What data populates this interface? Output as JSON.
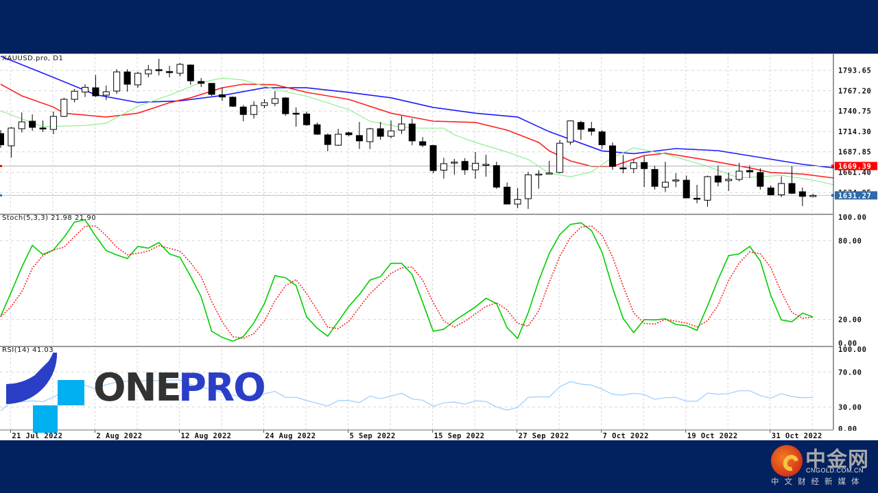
{
  "chart_header": {
    "symbol_timeframe": "XAUUSD.pro, D1"
  },
  "colors": {
    "background_band": "#03215f",
    "bull_candle": "#ffffff",
    "bear_candle": "#000000",
    "ma_blue": "#1a1aff",
    "ma_red": "#ff2020",
    "ma_green": "#90ee90",
    "stoch_main": "#00cc00",
    "stoch_signal": "#ff2020",
    "rsi": "#99ccff",
    "price_line_label": "#ff0000",
    "bid_line_label": "#2e6aa8"
  },
  "chart_data": [
    {
      "type": "candlestick",
      "title": "XAUUSD.pro, D1",
      "ylim": [
        1610,
        1816
      ],
      "grid": true,
      "y_ticks": [
        "1793.65",
        "1767.20",
        "1740.75",
        "1714.30",
        "1687.85",
        "1661.40",
        "1634.95"
      ],
      "x_tick_labels": [
        "21 Jul 2022",
        "2 Aug 2022",
        "12 Aug 2022",
        "24 Aug 2022",
        "5 Sep 2022",
        "15 Sep 2022",
        "27 Sep 2022",
        "7 Oct 2022",
        "19 Oct 2022",
        "31 Oct 2022"
      ],
      "ohlc": [
        [
          1711.5,
          1716,
          1693,
          1697
        ],
        [
          1695.6,
          1720,
          1680.5,
          1718.7
        ],
        [
          1717.8,
          1739,
          1713,
          1726.7
        ],
        [
          1727.6,
          1736.5,
          1715,
          1719.6
        ],
        [
          1718.8,
          1728.5,
          1713.5,
          1717.8
        ],
        [
          1716.9,
          1740,
          1710.7,
          1733.8
        ],
        [
          1733.8,
          1758,
          1733,
          1756
        ],
        [
          1756,
          1769.4,
          1752,
          1766.5
        ],
        [
          1765.5,
          1775.6,
          1759,
          1771.6
        ],
        [
          1771,
          1787.5,
          1759,
          1760.5
        ],
        [
          1761.4,
          1773.8,
          1755,
          1765.8
        ],
        [
          1766.7,
          1795,
          1763,
          1791.6
        ],
        [
          1791.6,
          1795,
          1766,
          1775.6
        ],
        [
          1774.8,
          1791.6,
          1771,
          1789.8
        ],
        [
          1789,
          1800.5,
          1784.5,
          1794.3
        ],
        [
          1794.5,
          1808.5,
          1787,
          1793.8
        ],
        [
          1792,
          1799.6,
          1784.5,
          1791
        ],
        [
          1789.8,
          1803,
          1786,
          1801.4
        ],
        [
          1800.5,
          1801.4,
          1774.8,
          1780
        ],
        [
          1779.2,
          1783.6,
          1772,
          1776.7
        ],
        [
          1776.7,
          1777,
          1760.5,
          1762.4
        ],
        [
          1762,
          1771,
          1754,
          1759
        ],
        [
          1758.8,
          1759.5,
          1746,
          1747
        ],
        [
          1746,
          1748.6,
          1727.6,
          1736.3
        ],
        [
          1736.3,
          1753.6,
          1731,
          1748
        ],
        [
          1748,
          1756,
          1744.5,
          1751.6
        ],
        [
          1750.7,
          1766.7,
          1747,
          1756.9
        ],
        [
          1757.8,
          1758.8,
          1734.5,
          1737.3
        ],
        [
          1738,
          1745.5,
          1720.5,
          1737
        ],
        [
          1737,
          1740,
          1721.6,
          1723
        ],
        [
          1723,
          1725.9,
          1709.8,
          1710.7
        ],
        [
          1709.8,
          1711.6,
          1688.5,
          1697.3
        ],
        [
          1696.4,
          1717.8,
          1695.5,
          1710.7
        ],
        [
          1712.5,
          1714,
          1708,
          1710
        ],
        [
          1709,
          1726.7,
          1691.5,
          1702
        ],
        [
          1701,
          1719,
          1691.5,
          1717.8
        ],
        [
          1717.8,
          1726.7,
          1703.5,
          1708
        ],
        [
          1708,
          1728.5,
          1705.4,
          1715
        ],
        [
          1716,
          1734.5,
          1711,
          1724
        ],
        [
          1724,
          1731,
          1696.4,
          1702
        ],
        [
          1701,
          1707,
          1694,
          1696.4
        ],
        [
          1696,
          1697,
          1660,
          1663.5
        ],
        [
          1664,
          1680,
          1653,
          1672.5
        ],
        [
          1674,
          1678.8,
          1658,
          1674.5
        ],
        [
          1675.4,
          1679.7,
          1658,
          1664.4
        ],
        [
          1664.4,
          1687.6,
          1653,
          1673
        ],
        [
          1671.5,
          1684,
          1655.6,
          1671.6
        ],
        [
          1670,
          1675,
          1639.7,
          1642
        ],
        [
          1642,
          1648,
          1620,
          1620
        ],
        [
          1620,
          1641,
          1614.6,
          1626
        ],
        [
          1627,
          1661.6,
          1613.7,
          1658
        ],
        [
          1658.5,
          1664,
          1640,
          1659
        ],
        [
          1660,
          1676,
          1659,
          1660.3
        ],
        [
          1661,
          1703,
          1660,
          1699
        ],
        [
          1700.5,
          1728.5,
          1697,
          1728
        ],
        [
          1726,
          1728,
          1703.5,
          1717
        ],
        [
          1718,
          1726.7,
          1709,
          1714.5
        ],
        [
          1713.7,
          1716,
          1691.5,
          1697
        ],
        [
          1695.6,
          1700,
          1664.4,
          1668.9
        ],
        [
          1667,
          1684,
          1660,
          1666.5
        ],
        [
          1666,
          1678,
          1660,
          1673.6
        ],
        [
          1674,
          1682,
          1642,
          1666
        ],
        [
          1665,
          1669.6,
          1638.8,
          1643
        ],
        [
          1642,
          1675,
          1636,
          1648.4
        ],
        [
          1651,
          1660,
          1642,
          1651.3
        ],
        [
          1651,
          1657,
          1628,
          1628
        ],
        [
          1627.6,
          1645,
          1621,
          1627
        ],
        [
          1625,
          1657,
          1616.5,
          1655.6
        ],
        [
          1656.5,
          1670,
          1643,
          1648.5
        ],
        [
          1650.4,
          1661,
          1637,
          1652.2
        ],
        [
          1652,
          1673.6,
          1649.4,
          1662.7
        ],
        [
          1663.6,
          1670,
          1654,
          1661.8
        ],
        [
          1661,
          1666.5,
          1638.8,
          1643
        ],
        [
          1641,
          1644,
          1631,
          1632
        ],
        [
          1632,
          1656,
          1629,
          1646.7
        ],
        [
          1646.7,
          1669,
          1633,
          1634
        ],
        [
          1636,
          1641.5,
          1617.3,
          1630
        ],
        [
          1629.8,
          1633,
          1629,
          1631.27
        ]
      ],
      "moving_averages": [
        {
          "color": "#1a1aff",
          "points": [
            [
              0,
              1812
            ],
            [
              5,
              1784.5
            ],
            [
              9,
              1762
            ],
            [
              13,
              1752
            ],
            [
              17,
              1754
            ],
            [
              21,
              1761
            ],
            [
              25,
              1771
            ],
            [
              29,
              1771
            ],
            [
              33,
              1765
            ],
            [
              37,
              1758
            ],
            [
              41,
              1745.5
            ],
            [
              45,
              1738
            ],
            [
              49,
              1733
            ],
            [
              52,
              1714
            ],
            [
              57,
              1689
            ],
            [
              60,
              1685.5
            ],
            [
              64,
              1692
            ],
            [
              68,
              1689.4
            ],
            [
              72,
              1680.5
            ],
            [
              76,
              1671.6
            ],
            [
              79,
              1667
            ]
          ]
        },
        {
          "color": "#ff2020",
          "points": [
            [
              0,
              1775.6
            ],
            [
              2,
              1760.5
            ],
            [
              5,
              1746
            ],
            [
              6,
              1738
            ],
            [
              10,
              1733
            ],
            [
              13,
              1738
            ],
            [
              16,
              1751.6
            ],
            [
              18,
              1758
            ],
            [
              21,
              1771
            ],
            [
              23,
              1775.6
            ],
            [
              26,
              1775
            ],
            [
              29,
              1765
            ],
            [
              33,
              1756
            ],
            [
              37,
              1738
            ],
            [
              41,
              1727.6
            ],
            [
              45,
              1726
            ],
            [
              48,
              1716
            ],
            [
              51,
              1700
            ],
            [
              52,
              1689
            ],
            [
              54,
              1676
            ],
            [
              56,
              1669
            ],
            [
              58,
              1669
            ],
            [
              61,
              1683
            ],
            [
              63,
              1686
            ],
            [
              67,
              1677
            ],
            [
              71,
              1667
            ],
            [
              73,
              1661
            ],
            [
              76,
              1659
            ],
            [
              79,
              1653.8
            ]
          ]
        },
        {
          "color": "#90ee90",
          "points": [
            [
              0,
              1741
            ],
            [
              4,
              1720.5
            ],
            [
              8,
              1722
            ],
            [
              10,
              1725
            ],
            [
              13,
              1747
            ],
            [
              16,
              1761.4
            ],
            [
              19,
              1778
            ],
            [
              21,
              1783.6
            ],
            [
              23,
              1781
            ],
            [
              26,
              1769
            ],
            [
              29,
              1760
            ],
            [
              33,
              1742.7
            ],
            [
              35,
              1727.6
            ],
            [
              38,
              1719.6
            ],
            [
              40,
              1718.5
            ],
            [
              42,
              1718.5
            ],
            [
              43,
              1710
            ],
            [
              45,
              1700
            ],
            [
              48,
              1687.6
            ],
            [
              50,
              1678
            ],
            [
              52,
              1660
            ],
            [
              54,
              1655.5
            ],
            [
              56,
              1661.8
            ],
            [
              58,
              1680.7
            ],
            [
              60,
              1693
            ],
            [
              63,
              1685
            ],
            [
              67,
              1669
            ],
            [
              70,
              1653.8
            ],
            [
              74,
              1657.3
            ],
            [
              77,
              1651
            ],
            [
              79,
              1645
            ]
          ]
        }
      ],
      "horizontal_lines": [
        {
          "value": 1669.39,
          "label": "1669.39",
          "color": "#ff0000"
        },
        {
          "value": 1631.27,
          "label": "1631.27",
          "color": "#2e6aa8"
        }
      ]
    },
    {
      "type": "line",
      "title": "Stoch(5,3,3) 21.98 21.90",
      "ylim": [
        0,
        100
      ],
      "y_ticks": [
        "100.00",
        "80.00",
        "20.00",
        "0.00"
      ],
      "series": [
        {
          "values": [
            22.6,
            40.9,
            60,
            76.5,
            69.6,
            73,
            82.6,
            94.3,
            96,
            83.5,
            72.5,
            69.2,
            66.4,
            75.7,
            74.4,
            78.6,
            70,
            67.3,
            53,
            37.4,
            11,
            6.4,
            3.5,
            7,
            17.4,
            32.2,
            53.4,
            51.8,
            46,
            22,
            13.4,
            7.3,
            18.6,
            30,
            39,
            50,
            52.7,
            62.8,
            62.8,
            54.4,
            33,
            11,
            12.7,
            19,
            24.3,
            29.6,
            36.2,
            32.2,
            13.9,
            5.6,
            25.2,
            49.6,
            70.4,
            84.7,
            92.5,
            93.7,
            87.8,
            71.3,
            44.3,
            20.9,
            10,
            20,
            19.7,
            20.5,
            16.2,
            15.3,
            11.8,
            30.4,
            50.4,
            68.7,
            70,
            75.7,
            64.7,
            38.3,
            19.7,
            18.3,
            24.9,
            21.98
          ],
          "color": "#00cc00",
          "style": "solid"
        },
        {
          "values": [
            22,
            30,
            41.2,
            59.1,
            68.7,
            73,
            75.1,
            83.3,
            91,
            91.3,
            84,
            75.1,
            69.4,
            70.4,
            72.2,
            76.2,
            74.3,
            72,
            63.4,
            52.6,
            33.8,
            18.3,
            7,
            5.6,
            9.3,
            18.9,
            34.3,
            45.8,
            50.4,
            39.9,
            27.1,
            14.2,
            13.1,
            18.6,
            29.2,
            39.7,
            47.2,
            55.2,
            59.4,
            60,
            50.1,
            32.8,
            18.9,
            14.2,
            18.7,
            24.3,
            30,
            32.7,
            27.4,
            17.2,
            14.9,
            26.8,
            48.4,
            68.2,
            82.5,
            90.3,
            91.3,
            84.3,
            67.8,
            45.5,
            25.1,
            17,
            16.6,
            20.1,
            18.8,
            17.3,
            14.4,
            19.2,
            30.9,
            49.8,
            63,
            71.5,
            70.1,
            59.6,
            40.9,
            25.4,
            21,
            21.9
          ],
          "color": "#ff2020",
          "style": "dotted"
        }
      ]
    },
    {
      "type": "line",
      "title": "RSI(14) 41.03",
      "ylim": [
        0,
        100
      ],
      "y_ticks": [
        "100.00",
        "70.00",
        "30.00",
        "0.00"
      ],
      "series": [
        {
          "values": [
            25.5,
            36,
            36,
            37,
            36,
            41.2,
            47.7,
            54.3,
            55.1,
            50.4,
            55.6,
            58.2,
            59.5,
            59.5,
            60.3,
            60,
            60.8,
            60.8,
            55.6,
            53,
            49.6,
            46.4,
            43.8,
            40.4,
            44.6,
            45.1,
            47.8,
            41,
            41,
            37.3,
            34.2,
            31,
            37.3,
            37.3,
            35,
            42.3,
            39.4,
            42.5,
            45.7,
            39.1,
            37.8,
            30.8,
            34.7,
            35.7,
            33.1,
            37,
            36.3,
            30,
            26.3,
            29.5,
            41,
            41.5,
            41.5,
            53,
            59,
            56.1,
            55,
            50.4,
            44.4,
            43.6,
            45.7,
            44.1,
            38.6,
            40.7,
            41,
            36.5,
            36.5,
            45.9,
            44.4,
            45.4,
            48.5,
            48.5,
            43,
            40.2,
            45.1,
            42,
            40.4,
            41.03
          ],
          "color": "#99ccff"
        }
      ]
    }
  ],
  "watermark": {
    "brand_one": "ONE",
    "brand_pro": "PRO"
  },
  "cngold_logo": {
    "name": "中金网",
    "domain": "CNGOLD.COM.CN",
    "tagline": "中文财经新媒体"
  }
}
